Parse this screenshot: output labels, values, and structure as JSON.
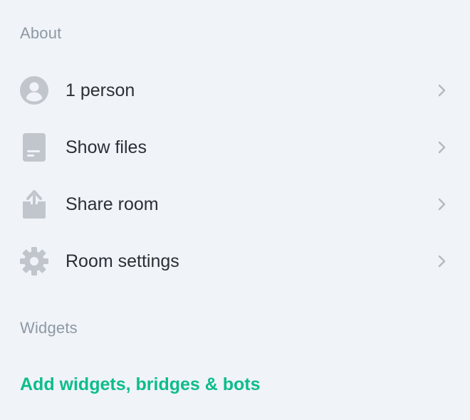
{
  "about": {
    "title": "About",
    "items": [
      {
        "label": "1 person",
        "icon": "person-icon"
      },
      {
        "label": "Show files",
        "icon": "file-icon"
      },
      {
        "label": "Share room",
        "icon": "share-icon"
      },
      {
        "label": "Room settings",
        "icon": "gear-icon"
      }
    ]
  },
  "widgets": {
    "title": "Widgets",
    "add_label": "Add widgets, bridges & bots"
  },
  "colors": {
    "background": "#f0f3f8",
    "section_title": "#8e99a4",
    "icon": "#c1c6cd",
    "accent": "#0dbd8b"
  }
}
